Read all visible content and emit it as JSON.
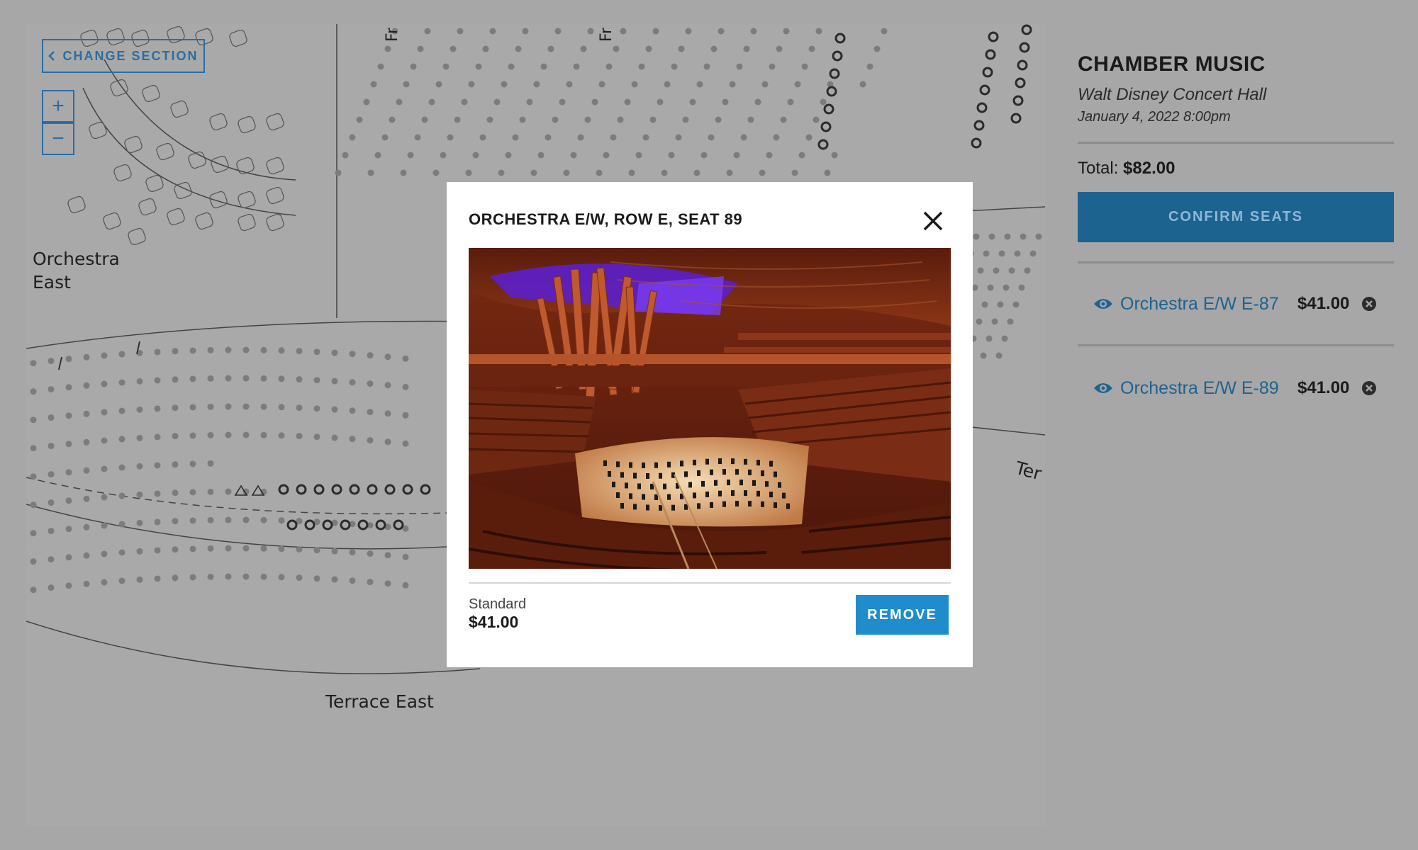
{
  "map": {
    "change_section_label": "CHANGE SECTION",
    "zoom_in_label": "+",
    "zoom_out_label": "−",
    "section_labels": {
      "orchestra_east": "Orchestra\nEast",
      "terrace_east": "Terrace East",
      "terrace_partial": "Ter",
      "front_1": "Fr",
      "front_2": "Fr"
    }
  },
  "sidebar": {
    "event_title": "CHAMBER MUSIC",
    "venue": "Walt Disney Concert Hall",
    "datetime": "January 4, 2022 8:00pm",
    "total_label": "Total:",
    "total_value": "$82.00",
    "confirm_label": "CONFIRM SEATS",
    "seats": [
      {
        "label": "Orchestra E/W E-87",
        "price": "$41.00"
      },
      {
        "label": "Orchestra E/W E-89",
        "price": "$41.00"
      }
    ]
  },
  "modal": {
    "title": "ORCHESTRA E/W, ROW E, SEAT 89",
    "price_type": "Standard",
    "price": "$41.00",
    "remove_label": "REMOVE"
  },
  "colors": {
    "accent_blue": "#1d6390",
    "button_blue": "#1f8ccb",
    "overlay_gray": "#a7a7a7"
  },
  "icons": {
    "close": "close-icon",
    "eye": "eye-icon",
    "remove": "remove-circle-icon",
    "chevron": "chevron-left-icon"
  }
}
